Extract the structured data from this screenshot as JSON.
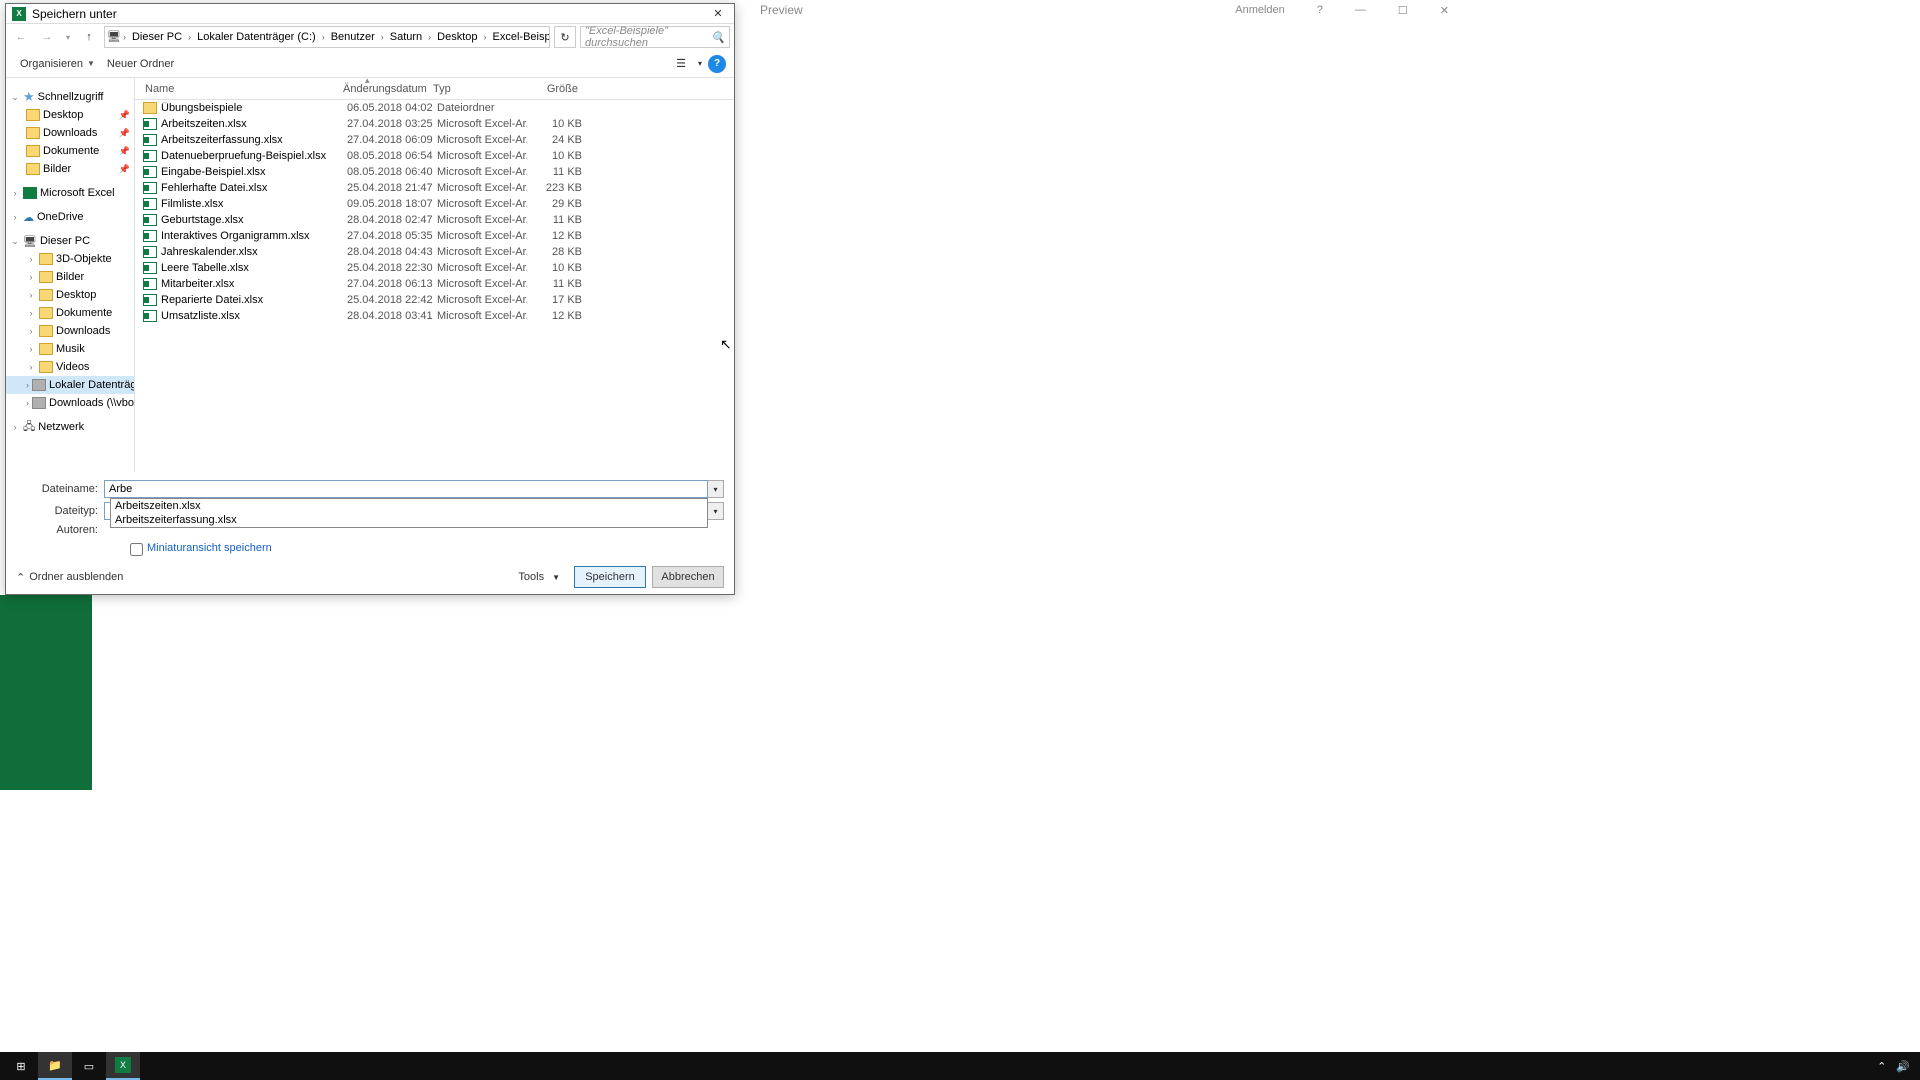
{
  "bg": {
    "title": "Preview",
    "signin": "Anmelden"
  },
  "dialog": {
    "title": "Speichern unter",
    "breadcrumb": [
      "Dieser PC",
      "Lokaler Datenträger (C:)",
      "Benutzer",
      "Saturn",
      "Desktop",
      "Excel-Beispiele"
    ],
    "search_placeholder": "\"Excel-Beispiele\" durchsuchen",
    "toolbar": {
      "organize": "Organisieren",
      "newfolder": "Neuer Ordner"
    },
    "columns": {
      "name": "Name",
      "date": "Änderungsdatum",
      "type": "Typ",
      "size": "Größe"
    },
    "tree": {
      "quick": "Schnellzugriff",
      "desktop": "Desktop",
      "downloads": "Downloads",
      "documents": "Dokumente",
      "pictures": "Bilder",
      "msexcel": "Microsoft Excel",
      "onedrive": "OneDrive",
      "thispc": "Dieser PC",
      "objects3d": "3D-Objekte",
      "pictures2": "Bilder",
      "desktop2": "Desktop",
      "documents2": "Dokumente",
      "downloads2": "Downloads",
      "music": "Musik",
      "videos": "Videos",
      "localdisk": "Lokaler Datenträger",
      "vbox": "Downloads (\\\\vbox",
      "network": "Netzwerk"
    },
    "files": [
      {
        "name": "Übungsbeispiele",
        "date": "06.05.2018 04:02",
        "type": "Dateiordner",
        "size": "",
        "kind": "folder"
      },
      {
        "name": "Arbeitszeiten.xlsx",
        "date": "27.04.2018 03:25",
        "type": "Microsoft Excel-Ar...",
        "size": "10 KB",
        "kind": "excel"
      },
      {
        "name": "Arbeitszeiterfassung.xlsx",
        "date": "27.04.2018 06:09",
        "type": "Microsoft Excel-Ar...",
        "size": "24 KB",
        "kind": "excel"
      },
      {
        "name": "Datenueberpruefung-Beispiel.xlsx",
        "date": "08.05.2018 06:54",
        "type": "Microsoft Excel-Ar...",
        "size": "10 KB",
        "kind": "excel"
      },
      {
        "name": "Eingabe-Beispiel.xlsx",
        "date": "08.05.2018 06:40",
        "type": "Microsoft Excel-Ar...",
        "size": "11 KB",
        "kind": "excel"
      },
      {
        "name": "Fehlerhafte Datei.xlsx",
        "date": "25.04.2018 21:47",
        "type": "Microsoft Excel-Ar...",
        "size": "223 KB",
        "kind": "excel"
      },
      {
        "name": "Filmliste.xlsx",
        "date": "09.05.2018 18:07",
        "type": "Microsoft Excel-Ar...",
        "size": "29 KB",
        "kind": "excel"
      },
      {
        "name": "Geburtstage.xlsx",
        "date": "28.04.2018 02:47",
        "type": "Microsoft Excel-Ar...",
        "size": "11 KB",
        "kind": "excel"
      },
      {
        "name": "Interaktives Organigramm.xlsx",
        "date": "27.04.2018 05:35",
        "type": "Microsoft Excel-Ar...",
        "size": "12 KB",
        "kind": "excel"
      },
      {
        "name": "Jahreskalender.xlsx",
        "date": "28.04.2018 04:43",
        "type": "Microsoft Excel-Ar...",
        "size": "28 KB",
        "kind": "excel"
      },
      {
        "name": "Leere Tabelle.xlsx",
        "date": "25.04.2018 22:30",
        "type": "Microsoft Excel-Ar...",
        "size": "10 KB",
        "kind": "excel"
      },
      {
        "name": "Mitarbeiter.xlsx",
        "date": "27.04.2018 06:13",
        "type": "Microsoft Excel-Ar...",
        "size": "11 KB",
        "kind": "excel"
      },
      {
        "name": "Reparierte Datei.xlsx",
        "date": "25.04.2018 22:42",
        "type": "Microsoft Excel-Ar...",
        "size": "17 KB",
        "kind": "excel"
      },
      {
        "name": "Umsatzliste.xlsx",
        "date": "28.04.2018 03:41",
        "type": "Microsoft Excel-Ar...",
        "size": "12 KB",
        "kind": "excel"
      }
    ],
    "form": {
      "filename_label": "Dateiname:",
      "filename_value": "Arbe",
      "filetype_label": "Dateityp:",
      "authors_label": "Autoren:",
      "thumbcheck": "Miniaturansicht speichern",
      "autocomplete": [
        "Arbeitszeiten.xlsx",
        "Arbeitszeiterfassung.xlsx"
      ]
    },
    "footer": {
      "hide": "Ordner ausblenden",
      "tools": "Tools",
      "save": "Speichern",
      "cancel": "Abbrechen"
    }
  }
}
